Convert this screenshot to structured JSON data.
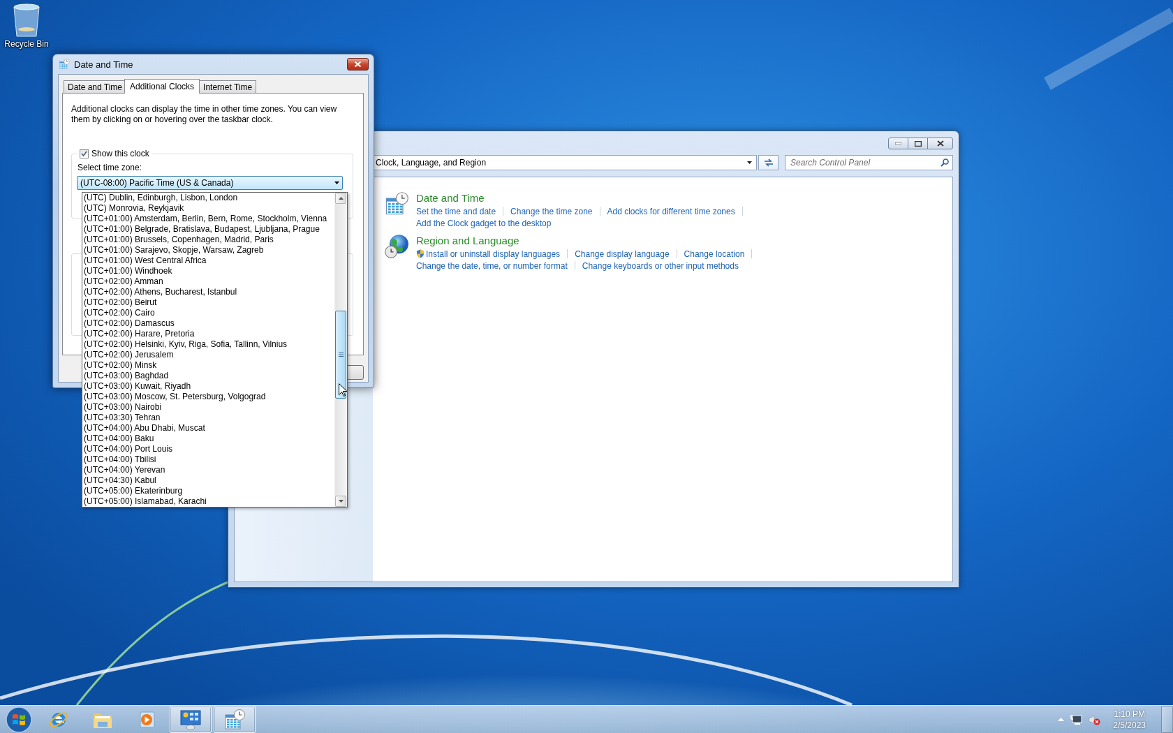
{
  "desktop_icons": [
    {
      "label": "Recycle Bin"
    }
  ],
  "dialog": {
    "title": "Date and Time",
    "tabs": [
      {
        "label": "Date and Time",
        "selected": false
      },
      {
        "label": "Additional Clocks",
        "selected": true
      },
      {
        "label": "Internet Time",
        "selected": false
      }
    ],
    "description": "Additional clocks can display the time in other time zones. You can view them by clicking on or hovering over the taskbar clock.",
    "clock_1": {
      "label": "Show this clock",
      "checked": true,
      "zone_label": "Select time zone:",
      "zone": "(UTC-08:00) Pacific Time (US & Canada)"
    },
    "zone_list": [
      {
        "label": "(UTC) Dublin, Edinburgh, Lisbon, London",
        "selected": false
      },
      {
        "label": "(UTC) Monrovia, Reykjavik",
        "selected": false
      },
      {
        "label": "(UTC+01:00) Amsterdam, Berlin, Bern, Rome, Stockholm, Vienna",
        "selected": false
      },
      {
        "label": "(UTC+01:00) Belgrade, Bratislava, Budapest, Ljubljana, Prague",
        "selected": false
      },
      {
        "label": "(UTC+01:00) Brussels, Copenhagen, Madrid, Paris",
        "selected": false
      },
      {
        "label": "(UTC+01:00) Sarajevo, Skopje, Warsaw, Zagreb",
        "selected": false
      },
      {
        "label": "(UTC+01:00) West Central Africa",
        "selected": false
      },
      {
        "label": "(UTC+01:00) Windhoek",
        "selected": false
      },
      {
        "label": "(UTC+02:00) Amman",
        "selected": false
      },
      {
        "label": "(UTC+02:00) Athens, Bucharest, Istanbul",
        "selected": false
      },
      {
        "label": "(UTC+02:00) Beirut",
        "selected": false
      },
      {
        "label": "(UTC+02:00) Cairo",
        "selected": false
      },
      {
        "label": "(UTC+02:00) Damascus",
        "selected": false
      },
      {
        "label": "(UTC+02:00) Harare, Pretoria",
        "selected": false
      },
      {
        "label": "(UTC+02:00) Helsinki, Kyiv, Riga, Sofia, Tallinn, Vilnius",
        "selected": false
      },
      {
        "label": "(UTC+02:00) Jerusalem",
        "selected": false
      },
      {
        "label": "(UTC+02:00) Minsk",
        "selected": false
      },
      {
        "label": "(UTC+03:00) Baghdad",
        "selected": false
      },
      {
        "label": "(UTC+03:00) Kuwait, Riyadh",
        "selected": false
      },
      {
        "label": "(UTC+03:00) Moscow, St. Petersburg, Volgograd",
        "selected": false
      },
      {
        "label": "(UTC+03:00) Nairobi",
        "selected": false
      },
      {
        "label": "(UTC+03:30) Tehran",
        "selected": false
      },
      {
        "label": "(UTC+04:00) Abu Dhabi, Muscat",
        "selected": false
      },
      {
        "label": "(UTC+04:00) Baku",
        "selected": false
      },
      {
        "label": "(UTC+04:00) Port Louis",
        "selected": false
      },
      {
        "label": "(UTC+04:00) Tbilisi",
        "selected": false
      },
      {
        "label": "(UTC+04:00) Yerevan",
        "selected": false
      },
      {
        "label": "(UTC+04:30) Kabul",
        "selected": false
      },
      {
        "label": "(UTC+05:00) Ekaterinburg",
        "selected": false
      },
      {
        "label": "(UTC+05:00) Islamabad, Karachi",
        "selected": false
      }
    ]
  },
  "control_panel": {
    "address": "Clock, Language, and Region",
    "search": {
      "placeholder": "Search Control Panel"
    },
    "sections": [
      {
        "kind": "datetime",
        "title": "Date and Time",
        "lines": [
          [
            {
              "text": "Set the time and date",
              "shield": false
            },
            {
              "text": "Change the time zone",
              "shield": false
            },
            {
              "text": "Add clocks for different time zones",
              "shield": false
            }
          ],
          [
            {
              "text": "Add the Clock gadget to the desktop",
              "shield": false
            }
          ]
        ]
      },
      {
        "kind": "region",
        "title": "Region and Language",
        "lines": [
          [
            {
              "text": "Install or uninstall display languages",
              "shield": true
            },
            {
              "text": "Change display language",
              "shield": false
            },
            {
              "text": "Change location",
              "shield": false
            }
          ],
          [
            {
              "text": "Change the date, time, or number format",
              "shield": false
            },
            {
              "text": "Change keyboards or other input methods",
              "shield": false
            }
          ]
        ]
      }
    ]
  },
  "taskbar": {
    "apps": [
      {
        "kind": "browser",
        "active": false
      },
      {
        "kind": "folder",
        "active": false
      },
      {
        "kind": "media",
        "active": false
      },
      {
        "kind": "control-panel",
        "active": true
      },
      {
        "kind": "calendar",
        "active": true
      }
    ],
    "clock": {
      "time": "1:10 PM",
      "date": "2/5/2023"
    }
  }
}
